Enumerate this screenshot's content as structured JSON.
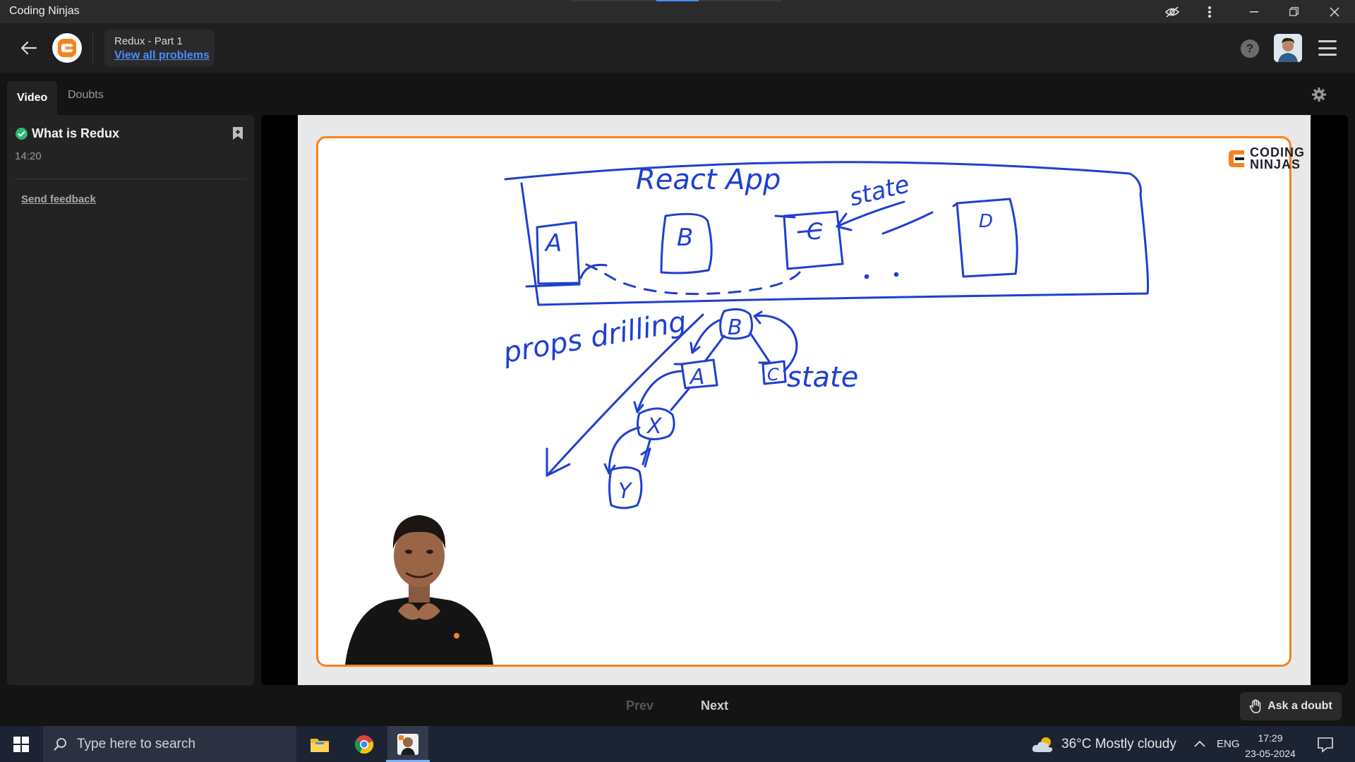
{
  "window": {
    "title": "Coding Ninjas",
    "controls": [
      "eye-off-icon",
      "more-vert-icon",
      "minimize-icon",
      "restore-icon",
      "close-icon"
    ]
  },
  "header": {
    "back_icon": "arrow-left-icon",
    "logo_icon": "coding-ninjas-logo",
    "problem_title": "Redux - Part 1",
    "view_all_link": "View all problems",
    "help_icon": "help-icon",
    "help_glyph": "?",
    "menu_icon": "hamburger-menu-icon"
  },
  "tabs": [
    {
      "label": "Video",
      "active": true
    },
    {
      "label": "Doubts",
      "active": false
    }
  ],
  "sidebar": {
    "lesson": {
      "title": "What is Redux",
      "duration": "14:20",
      "status": "completed",
      "status_color": "#2bb673"
    },
    "send_feedback": "Send feedback"
  },
  "video": {
    "brand_logo_line1": "CODING",
    "brand_logo_line2": "NINJAS",
    "whiteboard": {
      "box_label": "React App",
      "components": [
        "A",
        "B",
        "C",
        "D"
      ],
      "state_label_top": "state",
      "props_label": "props drilling",
      "tree_nodes": [
        "B",
        "A",
        "C",
        "X",
        "Y"
      ],
      "state_label_tree": "state"
    },
    "accent_color": "#f58220",
    "ink_color": "#1f3fd1"
  },
  "bottom_nav": {
    "prev": "Prev",
    "next": "Next",
    "ask_doubt": "Ask a doubt"
  },
  "taskbar": {
    "search_placeholder": "Type here to search",
    "apps": [
      "file-explorer-icon",
      "chrome-icon",
      "coding-ninjas-app-icon"
    ],
    "weather": "36°C  Mostly cloudy",
    "language": "ENG",
    "time": "17:29",
    "date": "23-05-2024"
  }
}
